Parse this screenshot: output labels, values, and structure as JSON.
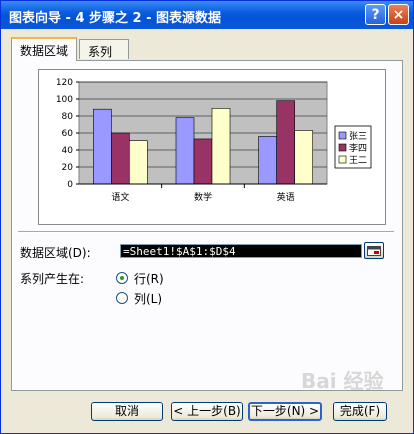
{
  "window": {
    "title": "图表向导 - 4 步骤之 2 - 图表源数据",
    "help_glyph": "?",
    "close_glyph": "×"
  },
  "tabs": [
    {
      "label": "数据区域",
      "active": true
    },
    {
      "label": "系列",
      "active": false
    }
  ],
  "chart_data": {
    "type": "bar",
    "categories": [
      "语文",
      "数学",
      "英语"
    ],
    "series": [
      {
        "name": "张三",
        "values": [
          88,
          78,
          56
        ],
        "color": "#9999ff"
      },
      {
        "name": "李四",
        "values": [
          60,
          53,
          98
        ],
        "color": "#993366"
      },
      {
        "name": "王二",
        "values": [
          51,
          89,
          63
        ],
        "color": "#ffffcc"
      }
    ],
    "ylim": [
      0,
      120
    ],
    "yticks": [
      "0",
      "20",
      "40",
      "60",
      "80",
      "100",
      "120"
    ],
    "grid": true,
    "legend": "right",
    "plot_background": "#c0c0c0"
  },
  "range": {
    "label": "数据区域(D):",
    "value": "=Sheet1!$A$1:$D$4"
  },
  "series_in": {
    "label": "系列产生在:",
    "options": [
      {
        "label": "行(R)",
        "selected": true
      },
      {
        "label": "列(L)",
        "selected": false
      }
    ]
  },
  "buttons": {
    "cancel": "取消",
    "back": "< 上一步(B)",
    "next": "下一步(N) >",
    "finish": "完成(F)"
  },
  "watermark": "Bai 经验"
}
